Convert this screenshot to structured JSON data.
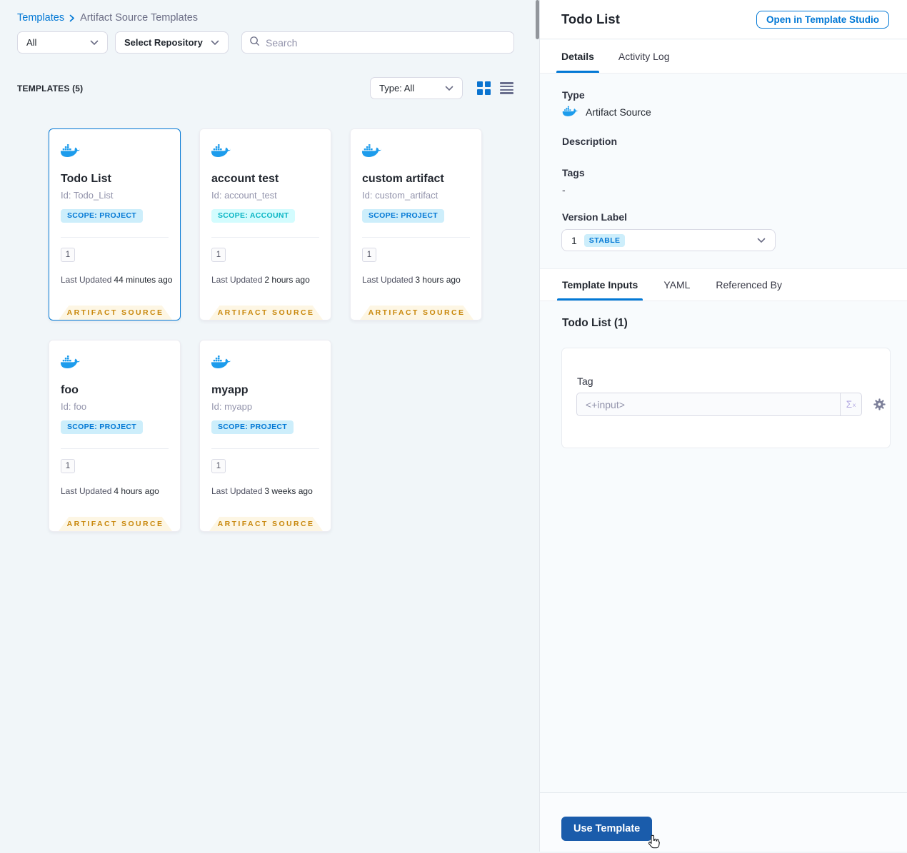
{
  "colors": {
    "accent": "#0278d5",
    "docker_blue": "#1d9cec",
    "scope_project_text": "#0278d5",
    "scope_account_text": "#0ab5c4",
    "ribbon_text": "#c8870b",
    "primary_button": "#1a5cab"
  },
  "icons": {
    "docker": "docker-whale-icon",
    "search": "magnifier-icon",
    "chevron": "chevron-down-icon",
    "grid": "grid-view-icon",
    "list": "list-view-icon",
    "gear": "settings-gear-icon",
    "sigma": "expression-sigma-icon"
  },
  "breadcrumb": {
    "link": "Templates",
    "current": "Artifact Source Templates"
  },
  "filters": {
    "scope": "All",
    "repository": "Select Repository",
    "search_placeholder": "Search"
  },
  "list_header": {
    "count": "TEMPLATES (5)",
    "type_filter": "Type: All"
  },
  "card_labels": {
    "last_updated": "Last Updated",
    "ribbon": "ARTIFACT SOURCE"
  },
  "cards": [
    {
      "name": "Todo List",
      "id": "Id: Todo_List",
      "scope": "SCOPE: PROJECT",
      "scope_type": "project",
      "version": "1",
      "last_updated": "44 minutes ago",
      "selected": true
    },
    {
      "name": "account test",
      "id": "Id: account_test",
      "scope": "SCOPE: ACCOUNT",
      "scope_type": "account",
      "version": "1",
      "last_updated": "2 hours ago",
      "selected": false
    },
    {
      "name": "custom artifact",
      "id": "Id: custom_artifact",
      "scope": "SCOPE: PROJECT",
      "scope_type": "project",
      "version": "1",
      "last_updated": "3 hours ago",
      "selected": false
    },
    {
      "name": "foo",
      "id": "Id: foo",
      "scope": "SCOPE: PROJECT",
      "scope_type": "project",
      "version": "1",
      "last_updated": "4 hours ago",
      "selected": false
    },
    {
      "name": "myapp",
      "id": "Id: myapp",
      "scope": "SCOPE: PROJECT",
      "scope_type": "project",
      "version": "1",
      "last_updated": "3 weeks ago",
      "selected": false
    }
  ],
  "panel": {
    "title": "Todo List",
    "open_button": "Open in Template Studio",
    "tabs": [
      "Details",
      "Activity Log"
    ],
    "details": {
      "type_label": "Type",
      "type_value": "Artifact Source",
      "description_label": "Description",
      "tags_label": "Tags",
      "tags_value": "-",
      "version_label": "Version Label",
      "version_value": "1",
      "version_badge": "STABLE"
    },
    "inputs_tabs": [
      "Template Inputs",
      "YAML",
      "Referenced By"
    ],
    "inputs_heading": "Todo List (1)",
    "tag": {
      "label": "Tag",
      "value": "<+input>",
      "sigma": "Σ",
      "sigma_sup": "x"
    },
    "use_template": "Use Template"
  }
}
